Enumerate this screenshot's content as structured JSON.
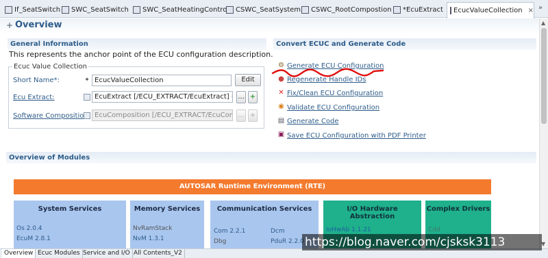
{
  "editor_tabs": [
    {
      "label": "If_SeatSwitch"
    },
    {
      "label": "SWC_SeatSwitch"
    },
    {
      "label": "SWC_SeatHeatingControl"
    },
    {
      "label": "CSWC_SeatSystem"
    },
    {
      "label": "CSWC_RootCompostion"
    },
    {
      "label": "*EcuExtract"
    },
    {
      "label": "EcucValueCollection",
      "active": true
    }
  ],
  "overflow_label": "»",
  "tab_close_glyph": "×",
  "page_title": "Overview",
  "general": {
    "title": "General Information",
    "description": "This represents the anchor point of the ECU configuration description.",
    "group_title": "Ecuc Value Collection",
    "short_name_label": "Short Name*:",
    "short_name_value": "EcucValueCollection",
    "edit_label": "Edit",
    "ecu_extract_label": "Ecu Extract:",
    "ecu_extract_value": "EcuExtract [/ECU_EXTRACT/EcuExtract] (/autrc",
    "software_composition_label": "Software Composition:",
    "software_composition_value": "EcuComposition [/ECU_EXTRACT/EcuCompos",
    "browse_label": "...",
    "add_glyph": "+"
  },
  "convert": {
    "title": "Convert ECUC and Generate Code",
    "actions": [
      {
        "label": "Generate ECU Configuration",
        "icon": "generate-config-icon"
      },
      {
        "label": "Regenerate Handle IDs",
        "icon": "regenerate-ids-icon"
      },
      {
        "label": "Fix/Clean ECU Configuration",
        "icon": "fix-clean-icon"
      },
      {
        "label": "Validate ECU Configuration",
        "icon": "validate-icon"
      },
      {
        "label": "Generate Code",
        "icon": "generate-code-icon"
      },
      {
        "label": "Save ECU Configuration with PDF Printer",
        "icon": "pdf-printer-icon"
      }
    ]
  },
  "modules": {
    "title": "Overview of Modules",
    "rte_label": "AUTOSAR Runtime Environment (RTE)",
    "boxes": [
      {
        "title": "System Services",
        "items": [
          "Os 2.0.4",
          "EcuM 2.8.1"
        ]
      },
      {
        "title": "Memory Services",
        "items": [
          "NvRamStack",
          "NvM 1.3.1"
        ]
      },
      {
        "title": "Communication Services",
        "items": [
          "Com 2.2.1",
          "Dcm",
          "Dbg",
          "PduR 2.2.0"
        ]
      },
      {
        "title": "I/O Hardware Abstraction",
        "items": [
          "IoHwAb 1.1.21"
        ]
      },
      {
        "title": "Complex Drivers",
        "items": [
          "Cdd"
        ]
      }
    ]
  },
  "bottom_tabs": [
    {
      "label": "Overview",
      "active": true
    },
    {
      "label": "Ecuc Modules"
    },
    {
      "label": "Service and I/O"
    },
    {
      "label": "All Contents_V2"
    }
  ],
  "watermark": "https://blog.naver.com/cjsksk3113",
  "colors": {
    "accent": "#2d5c8a",
    "rte": "#f47a2e",
    "module_blue": "#a9c6ee",
    "module_green": "#1fb08c",
    "scribble": "#e01010"
  }
}
